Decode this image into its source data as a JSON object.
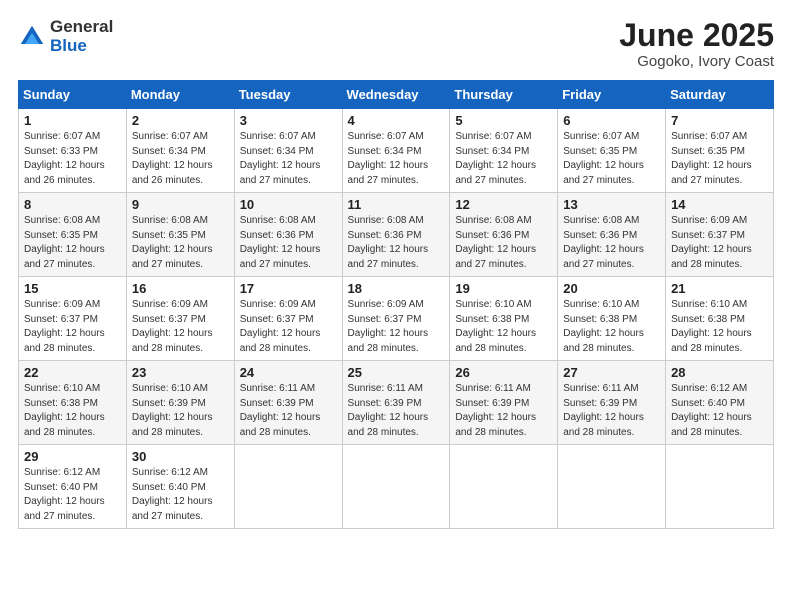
{
  "logo": {
    "general": "General",
    "blue": "Blue"
  },
  "title": "June 2025",
  "subtitle": "Gogoko, Ivory Coast",
  "weekdays": [
    "Sunday",
    "Monday",
    "Tuesday",
    "Wednesday",
    "Thursday",
    "Friday",
    "Saturday"
  ],
  "weeks": [
    [
      {
        "day": "1",
        "info": "Sunrise: 6:07 AM\nSunset: 6:33 PM\nDaylight: 12 hours\nand 26 minutes."
      },
      {
        "day": "2",
        "info": "Sunrise: 6:07 AM\nSunset: 6:34 PM\nDaylight: 12 hours\nand 26 minutes."
      },
      {
        "day": "3",
        "info": "Sunrise: 6:07 AM\nSunset: 6:34 PM\nDaylight: 12 hours\nand 27 minutes."
      },
      {
        "day": "4",
        "info": "Sunrise: 6:07 AM\nSunset: 6:34 PM\nDaylight: 12 hours\nand 27 minutes."
      },
      {
        "day": "5",
        "info": "Sunrise: 6:07 AM\nSunset: 6:34 PM\nDaylight: 12 hours\nand 27 minutes."
      },
      {
        "day": "6",
        "info": "Sunrise: 6:07 AM\nSunset: 6:35 PM\nDaylight: 12 hours\nand 27 minutes."
      },
      {
        "day": "7",
        "info": "Sunrise: 6:07 AM\nSunset: 6:35 PM\nDaylight: 12 hours\nand 27 minutes."
      }
    ],
    [
      {
        "day": "8",
        "info": "Sunrise: 6:08 AM\nSunset: 6:35 PM\nDaylight: 12 hours\nand 27 minutes."
      },
      {
        "day": "9",
        "info": "Sunrise: 6:08 AM\nSunset: 6:35 PM\nDaylight: 12 hours\nand 27 minutes."
      },
      {
        "day": "10",
        "info": "Sunrise: 6:08 AM\nSunset: 6:36 PM\nDaylight: 12 hours\nand 27 minutes."
      },
      {
        "day": "11",
        "info": "Sunrise: 6:08 AM\nSunset: 6:36 PM\nDaylight: 12 hours\nand 27 minutes."
      },
      {
        "day": "12",
        "info": "Sunrise: 6:08 AM\nSunset: 6:36 PM\nDaylight: 12 hours\nand 27 minutes."
      },
      {
        "day": "13",
        "info": "Sunrise: 6:08 AM\nSunset: 6:36 PM\nDaylight: 12 hours\nand 27 minutes."
      },
      {
        "day": "14",
        "info": "Sunrise: 6:09 AM\nSunset: 6:37 PM\nDaylight: 12 hours\nand 28 minutes."
      }
    ],
    [
      {
        "day": "15",
        "info": "Sunrise: 6:09 AM\nSunset: 6:37 PM\nDaylight: 12 hours\nand 28 minutes."
      },
      {
        "day": "16",
        "info": "Sunrise: 6:09 AM\nSunset: 6:37 PM\nDaylight: 12 hours\nand 28 minutes."
      },
      {
        "day": "17",
        "info": "Sunrise: 6:09 AM\nSunset: 6:37 PM\nDaylight: 12 hours\nand 28 minutes."
      },
      {
        "day": "18",
        "info": "Sunrise: 6:09 AM\nSunset: 6:37 PM\nDaylight: 12 hours\nand 28 minutes."
      },
      {
        "day": "19",
        "info": "Sunrise: 6:10 AM\nSunset: 6:38 PM\nDaylight: 12 hours\nand 28 minutes."
      },
      {
        "day": "20",
        "info": "Sunrise: 6:10 AM\nSunset: 6:38 PM\nDaylight: 12 hours\nand 28 minutes."
      },
      {
        "day": "21",
        "info": "Sunrise: 6:10 AM\nSunset: 6:38 PM\nDaylight: 12 hours\nand 28 minutes."
      }
    ],
    [
      {
        "day": "22",
        "info": "Sunrise: 6:10 AM\nSunset: 6:38 PM\nDaylight: 12 hours\nand 28 minutes."
      },
      {
        "day": "23",
        "info": "Sunrise: 6:10 AM\nSunset: 6:39 PM\nDaylight: 12 hours\nand 28 minutes."
      },
      {
        "day": "24",
        "info": "Sunrise: 6:11 AM\nSunset: 6:39 PM\nDaylight: 12 hours\nand 28 minutes."
      },
      {
        "day": "25",
        "info": "Sunrise: 6:11 AM\nSunset: 6:39 PM\nDaylight: 12 hours\nand 28 minutes."
      },
      {
        "day": "26",
        "info": "Sunrise: 6:11 AM\nSunset: 6:39 PM\nDaylight: 12 hours\nand 28 minutes."
      },
      {
        "day": "27",
        "info": "Sunrise: 6:11 AM\nSunset: 6:39 PM\nDaylight: 12 hours\nand 28 minutes."
      },
      {
        "day": "28",
        "info": "Sunrise: 6:12 AM\nSunset: 6:40 PM\nDaylight: 12 hours\nand 28 minutes."
      }
    ],
    [
      {
        "day": "29",
        "info": "Sunrise: 6:12 AM\nSunset: 6:40 PM\nDaylight: 12 hours\nand 27 minutes."
      },
      {
        "day": "30",
        "info": "Sunrise: 6:12 AM\nSunset: 6:40 PM\nDaylight: 12 hours\nand 27 minutes."
      },
      {
        "day": "",
        "info": ""
      },
      {
        "day": "",
        "info": ""
      },
      {
        "day": "",
        "info": ""
      },
      {
        "day": "",
        "info": ""
      },
      {
        "day": "",
        "info": ""
      }
    ]
  ]
}
